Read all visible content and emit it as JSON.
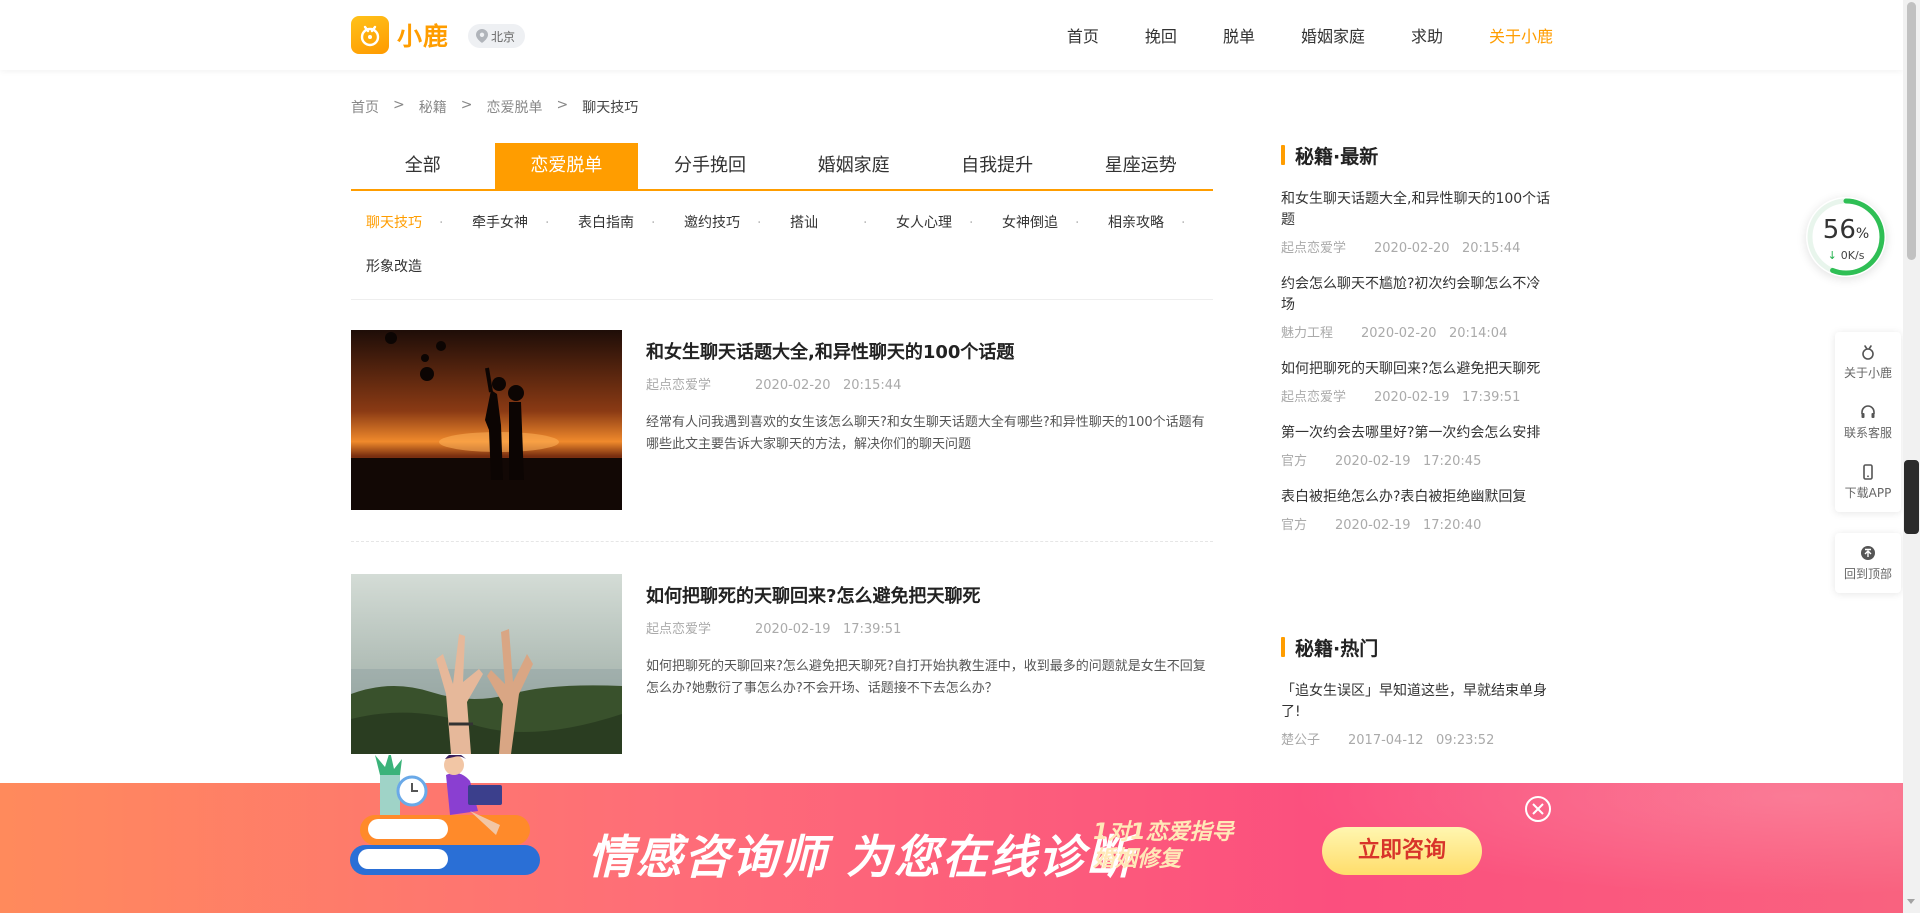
{
  "header": {
    "logo_text": "小鹿",
    "city": "北京",
    "nav": [
      "首页",
      "挽回",
      "脱单",
      "婚姻家庭",
      "求助",
      "关于小鹿"
    ],
    "nav_active_index": 5
  },
  "breadcrumb": [
    "首页",
    ">",
    "秘籍",
    ">",
    "恋爱脱单",
    ">",
    "聊天技巧"
  ],
  "tabs": [
    "全部",
    "恋爱脱单",
    "分手挽回",
    "婚姻家庭",
    "自我提升",
    "星座运势"
  ],
  "tabs_active_index": 1,
  "subtabs": [
    "聊天技巧",
    "牵手女神",
    "表白指南",
    "邀约技巧",
    "搭讪",
    "女人心理",
    "女神倒追",
    "相亲攻略",
    "形象改造"
  ],
  "subtabs_active_index": 0,
  "articles": [
    {
      "title": "和女生聊天话题大全,和异性聊天的100个话题",
      "author": "起点恋爱学",
      "time": "2020-02-20   20:15:44",
      "desc": "经常有人问我遇到喜欢的女生该怎么聊天?和女生聊天话题大全有哪些?和异性聊天的100个话题有哪些此文主要告诉大家聊天的方法，解决你们的聊天问题"
    },
    {
      "title": "如何把聊死的天聊回来?怎么避免把天聊死",
      "author": "起点恋爱学",
      "time": "2020-02-19   17:39:51",
      "desc": "如何把聊死的天聊回来?怎么避免把天聊死?自打开始执教生涯中，收到最多的问题就是女生不回复怎么办?她敷衍了事怎么办?不会开场、话题接不下去怎么办？"
    }
  ],
  "sidebar": {
    "latest_title": "秘籍·最新",
    "latest": [
      {
        "title": "和女生聊天话题大全,和异性聊天的100个话题",
        "author": "起点恋爱学",
        "time": "2020-02-20   20:15:44"
      },
      {
        "title": "约会怎么聊天不尴尬?初次约会聊怎么不冷场",
        "author": "魅力工程",
        "time": "2020-02-20   20:14:04"
      },
      {
        "title": "如何把聊死的天聊回来?怎么避免把天聊死",
        "author": "起点恋爱学",
        "time": "2020-02-19   17:39:51"
      },
      {
        "title": "第一次约会去哪里好?第一次约会怎么安排",
        "author": "官方",
        "time": "2020-02-19   17:20:45"
      },
      {
        "title": "表白被拒绝怎么办?表白被拒绝幽默回复",
        "author": "官方",
        "time": "2020-02-19   17:20:40"
      }
    ],
    "hot_title": "秘籍·热门",
    "hot": [
      {
        "title": "「追女生误区」早知道这些，早就结束单身了!",
        "author": "楚公子",
        "time": "2017-04-12   09:23:52"
      }
    ]
  },
  "speed_widget": {
    "percent": "56",
    "percent_sign": "%",
    "rate": "0K/s"
  },
  "tools": [
    "关于小鹿",
    "联系客服",
    "下载APP",
    "回到顶部"
  ],
  "banner": {
    "headline": "情感咨询师 为您在线诊断",
    "sub_line1": "1对1恋爱指导",
    "sub_line2": "婚姻修复",
    "cta": "立即咨询"
  },
  "colors": {
    "accent": "#ff9d00",
    "banner": "#fb4f7e"
  }
}
